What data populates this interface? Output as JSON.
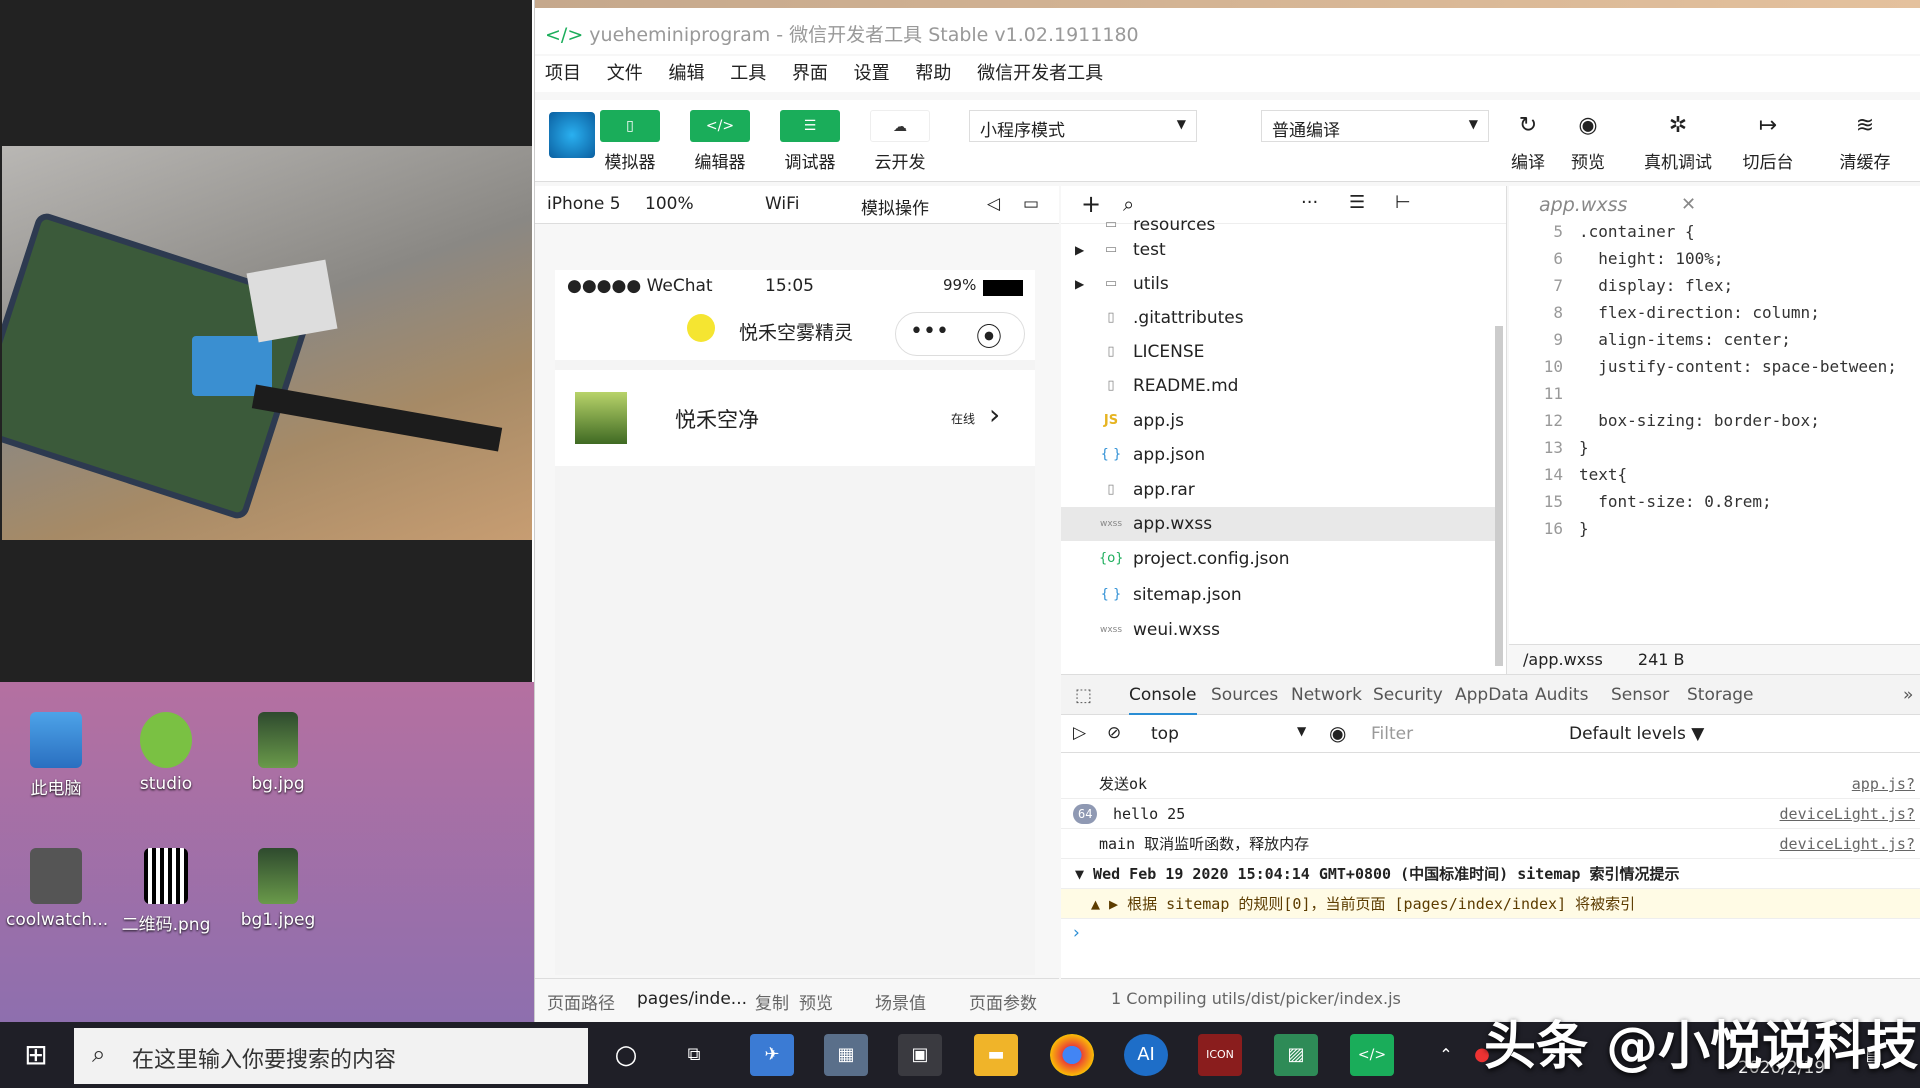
{
  "desktop": {
    "icons": [
      {
        "label": "此电脑",
        "icon": "computer-icon"
      },
      {
        "label": "studio",
        "icon": "android-studio-icon"
      },
      {
        "label": "bg.jpg",
        "icon": "image-file-icon"
      },
      {
        "label": "coolwatch...",
        "icon": "app-icon"
      },
      {
        "label": "二维码.png",
        "icon": "qr-code-icon"
      },
      {
        "label": "bg1.jpeg",
        "icon": "image-file-icon"
      }
    ]
  },
  "ide": {
    "title": "yueheminiprogram - 微信开发者工具 Stable v1.02.1911180",
    "menu": [
      "项目",
      "文件",
      "编辑",
      "工具",
      "界面",
      "设置",
      "帮助",
      "微信开发者工具"
    ],
    "toolbar": {
      "simulator": "模拟器",
      "editor": "编辑器",
      "debugger": "调试器",
      "cloud": "云开发",
      "mode": "小程序模式",
      "compile_mode": "普通编译",
      "compile": "编译",
      "preview": "预览",
      "real_debug": "真机调试",
      "background": "切后台",
      "clear_cache": "清缓存"
    },
    "simbar": {
      "device": "iPhone 5",
      "zoom": "100%",
      "network": "WiFi",
      "ops": "模拟操作"
    },
    "phone": {
      "carrier": "●●●●● WeChat",
      "time": "15:05",
      "battery": "99%",
      "nav_title": "悦禾空雾精灵",
      "device_name": "悦禾空净",
      "device_status": "在线"
    },
    "pathbar": {
      "label": "页面路径",
      "path": "pages/inde...",
      "copy": "复制",
      "preview": "预览",
      "scene": "场景值",
      "params": "页面参数"
    },
    "files": [
      {
        "name": "resources",
        "type": "folder"
      },
      {
        "name": "test",
        "type": "folder"
      },
      {
        "name": "utils",
        "type": "folder"
      },
      {
        "name": ".gitattributes",
        "type": "file"
      },
      {
        "name": "LICENSE",
        "type": "file"
      },
      {
        "name": "README.md",
        "type": "file"
      },
      {
        "name": "app.js",
        "type": "js"
      },
      {
        "name": "app.json",
        "type": "json"
      },
      {
        "name": "app.rar",
        "type": "file"
      },
      {
        "name": "app.wxss",
        "type": "wxss"
      },
      {
        "name": "project.config.json",
        "type": "config"
      },
      {
        "name": "sitemap.json",
        "type": "json"
      },
      {
        "name": "weui.wxss",
        "type": "wxss"
      }
    ],
    "file_icons": {
      "js": "JS",
      "json": "{ }",
      "wxss": "wxss",
      "config": "{o}"
    },
    "editor": {
      "tab": "app.wxss",
      "lines": [
        {
          "n": "5",
          "code": ".container {"
        },
        {
          "n": "6",
          "code": "  height: 100%;"
        },
        {
          "n": "7",
          "code": "  display: flex;"
        },
        {
          "n": "8",
          "code": "  flex-direction: column;"
        },
        {
          "n": "9",
          "code": "  align-items: center;"
        },
        {
          "n": "10",
          "code": "  justify-content: space-between;"
        },
        {
          "n": "11",
          "code": ""
        },
        {
          "n": "12",
          "code": "  box-sizing: border-box;"
        },
        {
          "n": "13",
          "code": "}"
        },
        {
          "n": "14",
          "code": "text{"
        },
        {
          "n": "15",
          "code": "  font-size: 0.8rem;"
        },
        {
          "n": "16",
          "code": "}"
        }
      ],
      "status_path": "/app.wxss",
      "status_size": "241 B"
    },
    "devtools": {
      "tabs": [
        "Console",
        "Sources",
        "Network",
        "Security",
        "AppData",
        "Audits",
        "Sensor",
        "Storage"
      ],
      "context": "top",
      "filter_placeholder": "Filter",
      "levels": "Default levels ▼",
      "logs": [
        {
          "badge": "",
          "text": "发送ok",
          "src": "app.js?"
        },
        {
          "badge": "64",
          "text": "hello 25",
          "src": "deviceLight.js?"
        },
        {
          "badge": "",
          "text": "main 取消监听函数，释放内存",
          "src": "deviceLight.js?"
        },
        {
          "badge": "",
          "text": "▼ Wed Feb 19 2020 15:04:14 GMT+0800 (中国标准时间) sitemap 索引情况提示",
          "src": ""
        },
        {
          "badge": "",
          "text": "▲ ▶ 根据 sitemap 的规则[0]，当前页面 [pages/index/index] 将被索引",
          "src": ""
        }
      ],
      "compile_msg": "1 Compiling utils/dist/picker/index.js"
    }
  },
  "taskbar": {
    "search_placeholder": "在这里输入你要搜索的内容",
    "clock": "2020/2/19"
  },
  "watermark": "头条 @小悦说科技",
  "colors": {
    "green": "#1aad5a",
    "accent": "#2a8dd4"
  }
}
